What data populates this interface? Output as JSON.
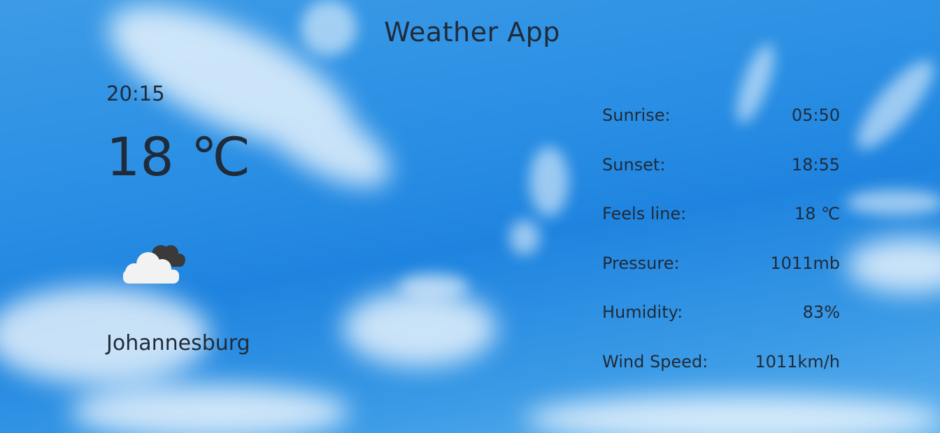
{
  "app": {
    "title": "Weather App"
  },
  "current": {
    "time": "20:15",
    "temperature": "18 ℃",
    "condition_icon": "partly-cloudy-dark-icon",
    "city": "Johannesburg"
  },
  "details": [
    {
      "label": "Sunrise:",
      "value": "05:50"
    },
    {
      "label": "Sunset:",
      "value": "18:55"
    },
    {
      "label": "Feels line:",
      "value": "18 ℃"
    },
    {
      "label": "Pressure:",
      "value": "1011mb"
    },
    {
      "label": "Humidity:",
      "value": "83%"
    },
    {
      "label": "Wind Speed:",
      "value": "1011km/h"
    }
  ],
  "colors": {
    "sky": "#2a8fe4",
    "text": "#1f2b3a",
    "cloud_light": "#f2f2f2",
    "cloud_dark": "#3a3a3a"
  }
}
